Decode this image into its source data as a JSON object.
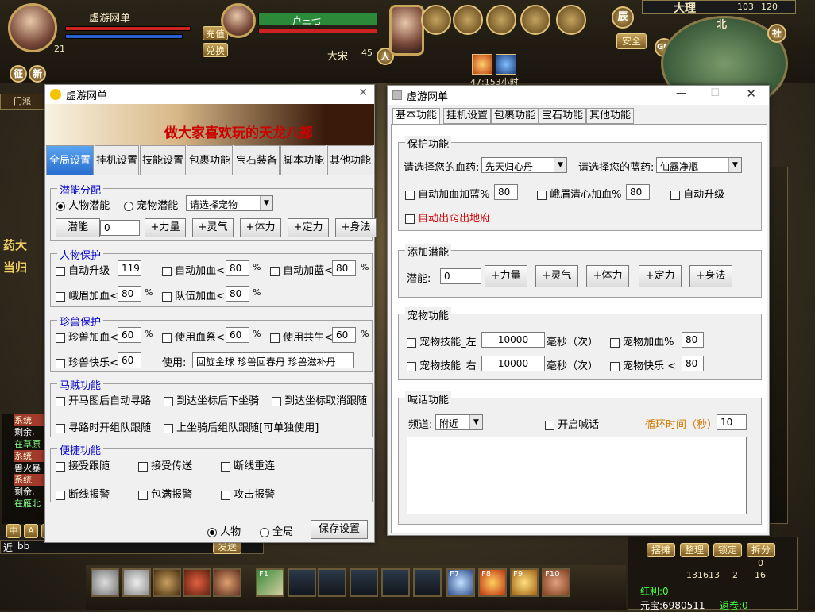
{
  "game": {
    "player_name": "虚游网单",
    "player_level": "21",
    "target_name": "卢三七",
    "target_faction": "大宋",
    "target_level": "45",
    "target_badge": "人",
    "btn_recharge": "充值",
    "btn_exchange": "兑换",
    "btn_zheng": "征",
    "btn_xin": "新",
    "online_time": "47:153小时",
    "btn_safe": "安全",
    "btn_chen": "辰",
    "map_name": "大理",
    "map_x": "103",
    "map_y": "120",
    "compass": "北",
    "btn_she": "社",
    "btn_gm": "GM",
    "chat_lines": [
      "系统",
      "剩余,",
      "在草原",
      "系统",
      "兽火暴",
      "系统",
      "剩余,",
      "在雁北"
    ],
    "chat_input_prefix": "近",
    "chat_input_value": "bb",
    "btn_send": "发送",
    "bag_buttons": [
      "摆摊",
      "整理",
      "锁定",
      "拆分"
    ],
    "gold_value": "131613",
    "silver_value": "2",
    "copper_value": "16",
    "zero_value": "0",
    "red_profit": "红利:0",
    "yuanbao": "元宝:6980511",
    "fanjuan": "返卷:0",
    "fkeys": [
      "F1",
      "F7",
      "F8",
      "F9",
      "F10"
    ],
    "left_sign": "门派",
    "left_npc_1": "药大",
    "left_npc_2": "当归",
    "chat_icons": [
      "中",
      "A",
      "◎"
    ]
  },
  "left_window": {
    "title": "虚游网单",
    "banner_text": "做大家喜欢玩的天龙八部",
    "tabs": [
      "全局设置",
      "挂机设置",
      "技能设置",
      "包裹功能",
      "宝石装备",
      "脚本功能",
      "其他功能"
    ],
    "potential": {
      "title": "潜能分配",
      "radio_person": "人物潜能",
      "radio_pet": "宠物潜能",
      "pet_select": "请选择宠物",
      "btn_potential": "潜能",
      "value": "0",
      "buttons": [
        "+力量",
        "+灵气",
        "+体力",
        "+定力",
        "+身法"
      ]
    },
    "person_protect": {
      "title": "人物保护",
      "auto_upgrade": "自动升级",
      "auto_upgrade_val": "119",
      "auto_hp": "自动加血<",
      "auto_hp_val": "80",
      "auto_mp": "自动加蓝<",
      "auto_mp_val": "80",
      "emei": "峨眉加血<",
      "emei_val": "80",
      "team": "队伍加血<",
      "team_val": "80",
      "pct": "%"
    },
    "pet_protect": {
      "title": "珍兽保护",
      "pet_hp": "珍兽加血<",
      "pet_hp_val": "60",
      "use_blood": "使用血祭<",
      "use_blood_val": "60",
      "use_share": "使用共生<",
      "use_share_val": "60",
      "pet_happy": "珍兽快乐<",
      "pet_happy_val": "60",
      "use_label": "使用:",
      "use_items": "回旋金球 珍兽回春丹 珍兽滋补丹",
      "pct": "%"
    },
    "thief": {
      "title": "马贼功能",
      "items": [
        "开马图后自动寻路",
        "到达坐标后下坐骑",
        "到达坐标取消跟随",
        "寻路时开组队跟随",
        "上坐骑后组队跟随[可单独使用]"
      ]
    },
    "shortcut": {
      "title": "便捷功能",
      "items": [
        "接受跟随",
        "接受传送",
        "断线重连",
        "断线报警",
        "包满报警",
        "攻击报警"
      ]
    },
    "radio_person": "人物",
    "radio_all": "全局",
    "btn_save": "保存设置"
  },
  "right_window": {
    "title": "虚游网单",
    "tabs": [
      "基本功能",
      "挂机设置",
      "包裹功能",
      "宝石功能",
      "其他功能"
    ],
    "protect": {
      "title": "保护功能",
      "hp_label": "请选择您的血药:",
      "hp_value": "先天归心丹",
      "mp_label": "请选择您的蓝药:",
      "mp_value": "仙露净瓶",
      "auto_hpmp": "自动加血加蓝%",
      "auto_hpmp_val": "80",
      "emei": "峨眉清心加血%",
      "emei_val": "80",
      "auto_upgrade": "自动升级",
      "auto_out": "自动出窍出地府"
    },
    "potential": {
      "title": "添加潜能",
      "label": "潜能:",
      "value": "0",
      "buttons": [
        "+力量",
        "+灵气",
        "+体力",
        "+定力",
        "+身法"
      ]
    },
    "pet": {
      "title": "宠物功能",
      "skill_left": "宠物技能_左",
      "skill_left_val": "10000",
      "skill_right": "宠物技能_右",
      "skill_right_val": "10000",
      "ms_unit": "毫秒（次）",
      "pet_hp": "宠物加血%",
      "pet_hp_val": "80",
      "pet_happy": "宠物快乐 <",
      "pet_happy_val": "80"
    },
    "shout": {
      "title": "喊话功能",
      "channel_label": "频道:",
      "channel_value": "附近",
      "enable": "开启喊话",
      "cycle_label": "循环时间（秒）",
      "cycle_val": "10"
    }
  }
}
